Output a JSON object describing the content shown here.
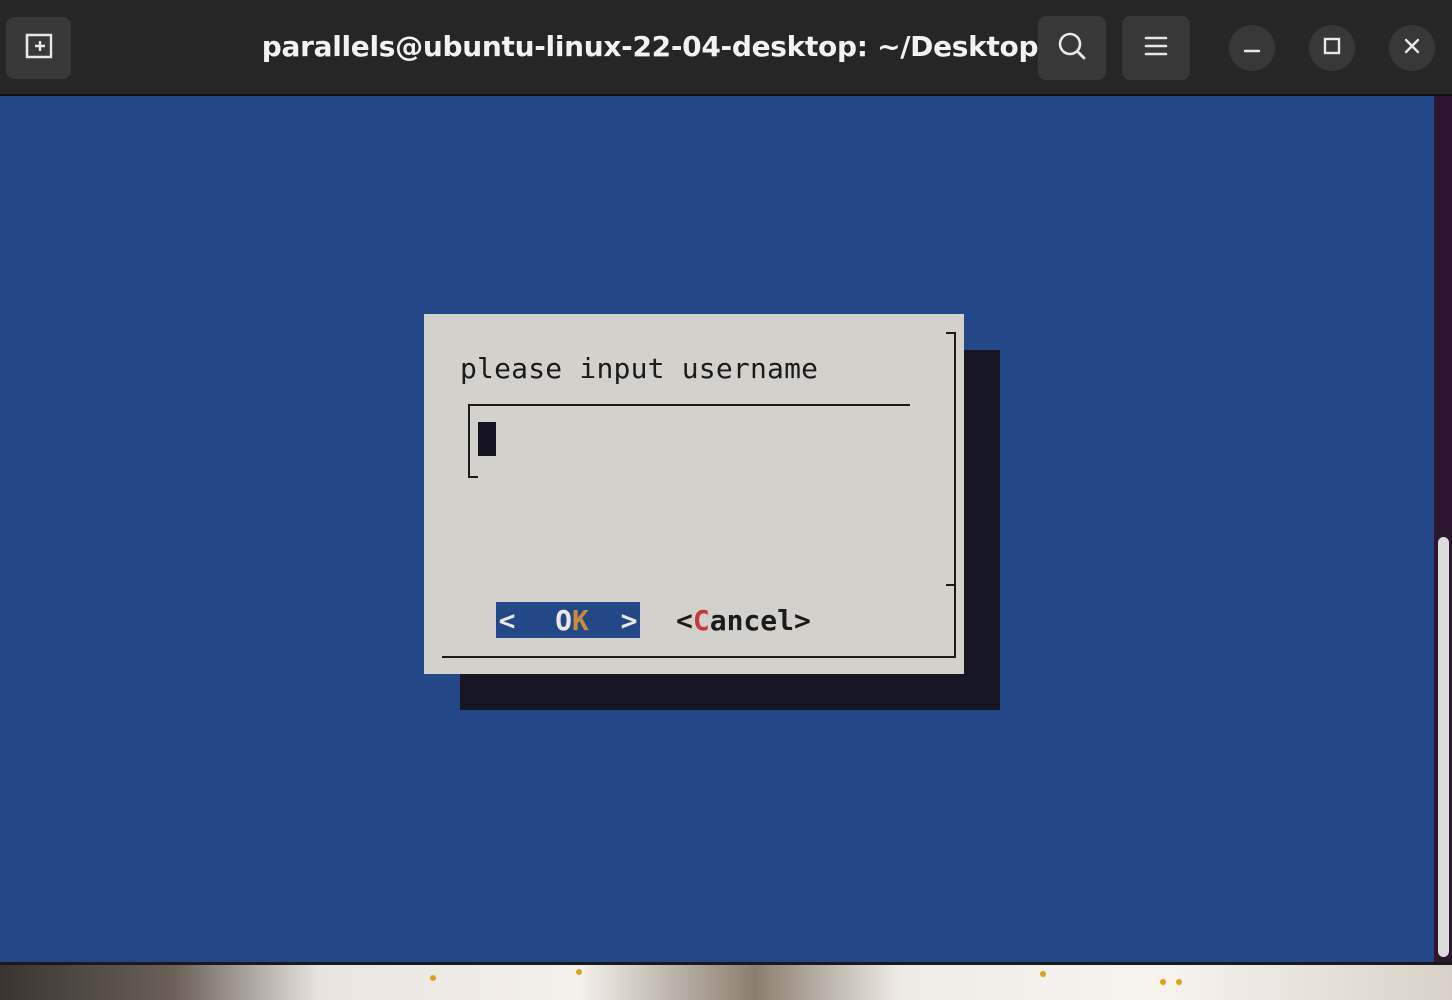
{
  "window": {
    "title": "parallels@ubuntu-linux-22-04-desktop: ~/Desktop"
  },
  "titlebar": {
    "new_tab_icon": "new-tab-icon",
    "search_icon": "search-icon",
    "menu_icon": "hamburger-menu-icon",
    "minimize_icon": "minimize-icon",
    "maximize_icon": "maximize-icon",
    "close_icon": "close-icon"
  },
  "dialog": {
    "prompt": "please input username",
    "input_value": "",
    "ok": {
      "left_bracket": "<",
      "label_start": "O",
      "label_hotkey": "K",
      "right_bracket": ">"
    },
    "cancel": {
      "open": "<",
      "hotkey": "C",
      "rest": "ancel",
      "close": ">"
    }
  },
  "colors": {
    "terminal_bg": "#244887",
    "dialog_bg": "#d3d1cc",
    "shadow": "#171724",
    "ok_hotkey": "#c98a3a",
    "cancel_hotkey": "#c43a3a"
  }
}
